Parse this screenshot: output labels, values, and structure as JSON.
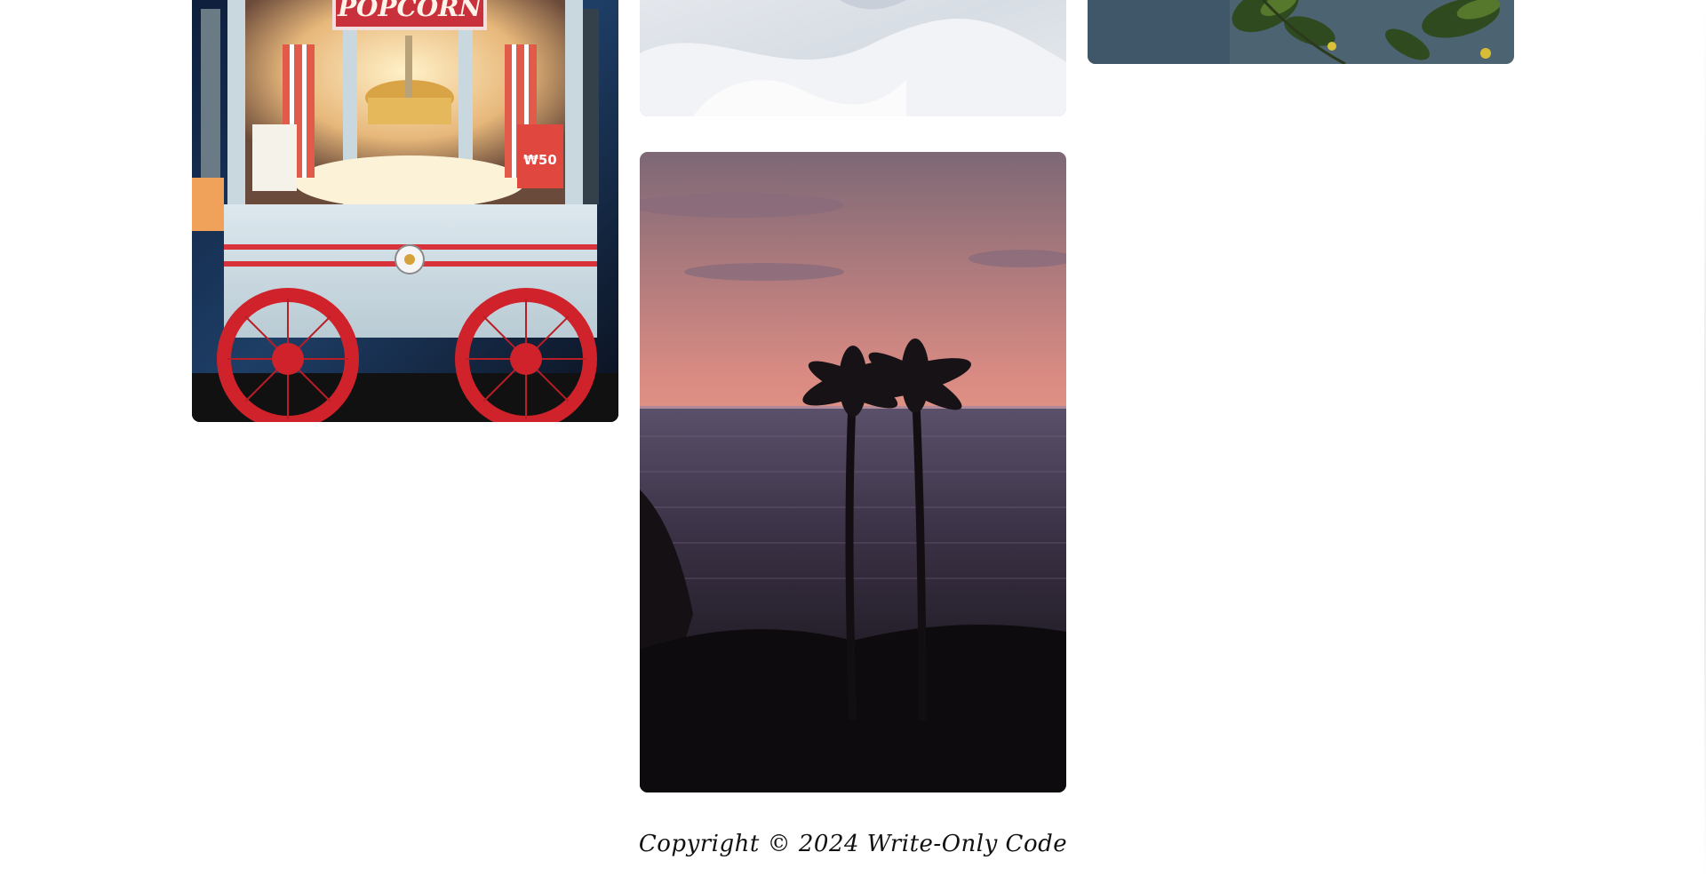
{
  "gallery": {
    "images": [
      {
        "subject": "popcorn-cart",
        "sign_text": "POPCORN",
        "price_tag": "₩50"
      },
      {
        "subject": "white-fabric"
      },
      {
        "subject": "green-leaves"
      },
      {
        "subject": "sunset-palm-trees"
      }
    ]
  },
  "footer": {
    "copyright": "Copyright © 2024 Write-Only Code"
  },
  "colors": {
    "page_background": "#ffffff",
    "footer_text": "#111111"
  }
}
